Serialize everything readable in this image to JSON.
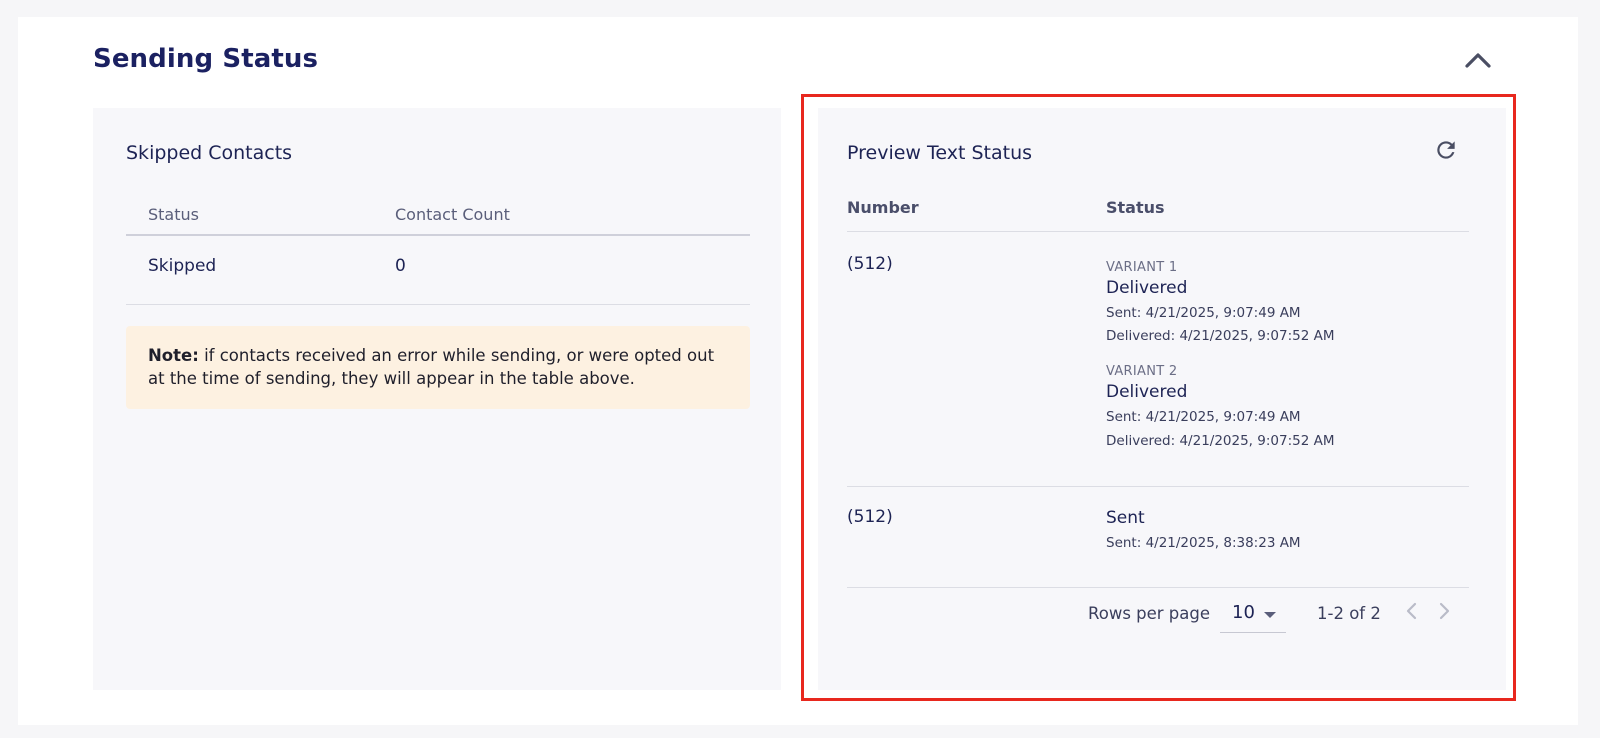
{
  "header": {
    "title": "Sending Status"
  },
  "skipped": {
    "title": "Skipped Contacts",
    "columns": [
      "Status",
      "Contact Count"
    ],
    "rows": [
      {
        "status": "Skipped",
        "count": "0"
      }
    ],
    "note_bold": "Note:",
    "note_text": " if contacts received an error while sending, or were opted out at the time of sending, they will appear in the table above."
  },
  "preview": {
    "title": "Preview Text Status",
    "columns": [
      "Number",
      "Status"
    ],
    "rows": [
      {
        "number": "(512)",
        "variants": [
          {
            "label": "VARIANT 1",
            "status": "Delivered",
            "sent": "Sent: 4/21/2025, 9:07:49 AM",
            "delivered": "Delivered: 4/21/2025, 9:07:52 AM"
          },
          {
            "label": "VARIANT 2",
            "status": "Delivered",
            "sent": "Sent: 4/21/2025, 9:07:49 AM",
            "delivered": "Delivered: 4/21/2025, 9:07:52 AM"
          }
        ]
      },
      {
        "number": "(512)",
        "status": "Sent",
        "sent": "Sent: 4/21/2025, 8:38:23 AM"
      }
    ],
    "pagination": {
      "rows_per_page_label": "Rows per page",
      "rows_per_page_value": "10",
      "range": "1-2 of 2"
    }
  },
  "icons": {
    "collapse": "chevron-up-icon",
    "refresh": "refresh-icon",
    "prev": "chevron-left-icon",
    "next": "chevron-right-icon",
    "dropdown": "caret-down-icon"
  },
  "colors": {
    "title": "#1b2161",
    "highlight_border": "#e8281e",
    "note_background": "#fdf1e1",
    "panel_background": "#f7f7fa"
  }
}
